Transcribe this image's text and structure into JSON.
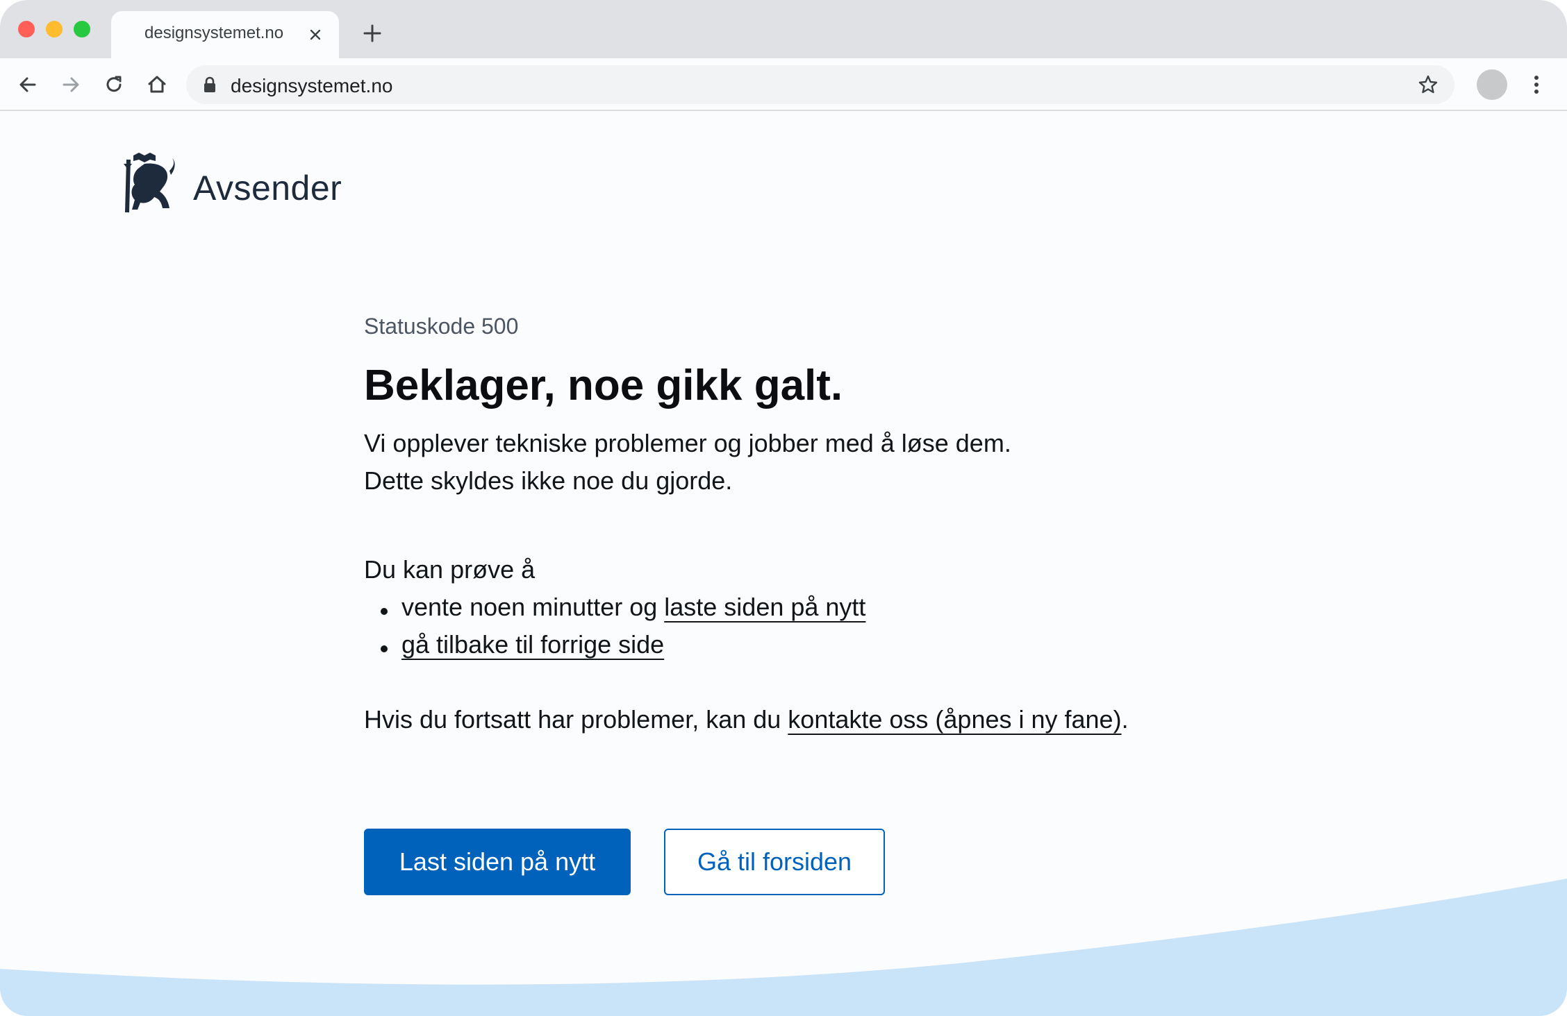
{
  "browser": {
    "tab_title": "designsystemet.no",
    "url": "designsystemet.no",
    "icons": {
      "close": "close-icon",
      "new_tab": "plus-icon",
      "back": "arrow-left-icon",
      "forward": "arrow-right-icon",
      "reload": "reload-icon",
      "home": "home-icon",
      "lock": "lock-icon",
      "bookmark": "star-icon",
      "profile": "avatar",
      "menu": "kebab-menu-icon"
    }
  },
  "header": {
    "brand": "Avsender",
    "logo": "norwegian-lion-coat-of-arms"
  },
  "error": {
    "status": "Statuskode 500",
    "title": "Beklager, noe gikk galt.",
    "line1": "Vi opplever tekniske problemer og jobber med å løse dem.",
    "line2": "Dette skyldes ikke noe du gjorde.",
    "try_intro": "Du kan prøve å",
    "item1_text": "vente noen minutter og ",
    "item1_link": "laste siden på nytt",
    "item2_link": "gå tilbake til forrige side",
    "contact_text": "Hvis du fortsatt har problemer, kan du ",
    "contact_link": "kontakte oss (åpnes i ny fane)",
    "contact_end": "."
  },
  "actions": {
    "reload_label": "Last siden på nytt",
    "home_label": "Gå til forsiden"
  },
  "colors": {
    "accent": "#0062ba",
    "wave": "#c9e3f9",
    "tab_strip": "#dfe1e5",
    "text_dark": "#1e2b3c"
  }
}
